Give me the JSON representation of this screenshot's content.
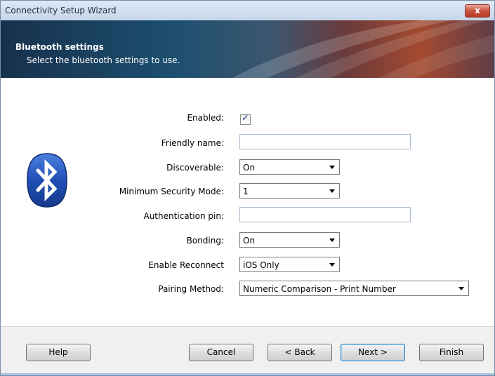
{
  "window": {
    "title": "Connectivity Setup Wizard",
    "close_label": "x"
  },
  "banner": {
    "title": "Bluetooth settings",
    "subtitle": "Select the bluetooth settings to use."
  },
  "form": {
    "enabled_label": "Enabled:",
    "enabled_checked": true,
    "enabled_mark": "✓",
    "friendly_name_label": "Friendly name:",
    "friendly_name_value": "",
    "discoverable_label": "Discoverable:",
    "discoverable_value": "On",
    "min_security_label": "Minimum Security Mode:",
    "min_security_value": "1",
    "auth_pin_label": "Authentication pin:",
    "auth_pin_value": "",
    "bonding_label": "Bonding:",
    "bonding_value": "On",
    "reconnect_label": "Enable Reconnect",
    "reconnect_value": "iOS Only",
    "pairing_label": "Pairing Method:",
    "pairing_value": "Numeric Comparison - Print Number"
  },
  "footer": {
    "help": "Help",
    "cancel": "Cancel",
    "back": "< Back",
    "next": "Next >",
    "finish": "Finish"
  },
  "colors": {
    "bluetooth_blue": "#1f4fb5",
    "banner_dark": "#17314d",
    "banner_orange": "#a44a30"
  }
}
